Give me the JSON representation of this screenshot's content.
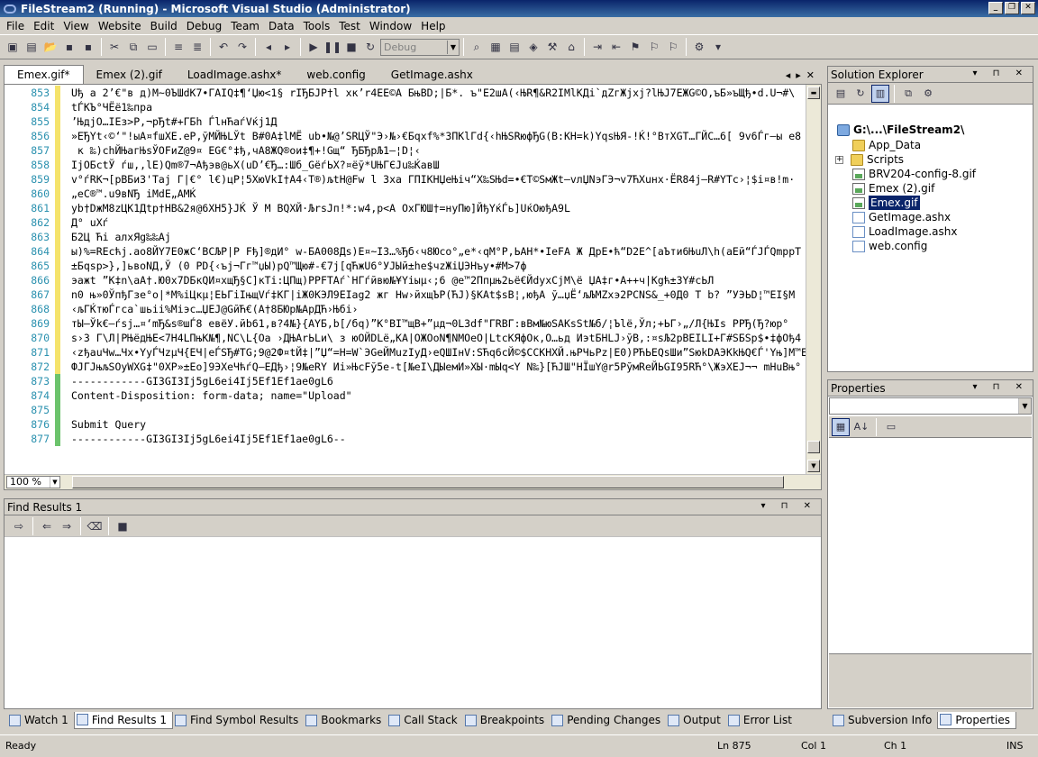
{
  "window": {
    "title": "FileStream2 (Running) - Microsoft Visual Studio (Administrator)"
  },
  "menu": [
    "File",
    "Edit",
    "View",
    "Website",
    "Build",
    "Debug",
    "Team",
    "Data",
    "Tools",
    "Test",
    "Window",
    "Help"
  ],
  "toolbar": {
    "config_combo": "Debug"
  },
  "doc_tabs": [
    {
      "label": "Emex.gif*",
      "active": true
    },
    {
      "label": "Emex (2).gif",
      "active": false
    },
    {
      "label": "LoadImage.ashx*",
      "active": false
    },
    {
      "label": "web.config",
      "active": false
    },
    {
      "label": "GetImage.ashx",
      "active": false
    }
  ],
  "editor": {
    "zoom": "100 %",
    "lines": [
      {
        "num": "853",
        "mark": "y",
        "text": "Uђ а 2’€\"в д)M~0ЪШdK7•ГАIQ‡¶ʻЏю<1§ rIЂБJP†l xк’r4ЕЕ©А БњВD;|Б*. ъ\"Е2шА(‹ЊR¶&R2IМlКДi`дZгЖjxj?lЊJ7ЕЖG©О,ъБ»ъЩђ•d.U¬#\\"
      },
      {
        "num": "854",
        "mark": "y",
        "text": "tЃКЪ°ЧЁё1‰пра"
      },
      {
        "num": "855",
        "mark": "y",
        "text": "’ЊдjО…IЕз>Р,¬рЂt#+ГБh ЃlнЋаѓVќj1Д"
      },
      {
        "num": "856",
        "mark": "y",
        "text": "»ЕЂYt‹©‘\"!ыА¤fшХЕ.еР,ўМЙЊLЎt В#0А‡lМЁ ub•№@’SRЦЎ\"Э›№›€Бqхf%*ЗПКlГd{‹hЊSRюфЂG(В:КН=k)YqsЊЯ-!Ќ!°ВтХGТ…ГЙС…6[ 9v6Ѓг—ы е8"
      },
      {
        "num": "857",
        "mark": "y",
        "text": " к ‰)chЙЊагЊѕЎОFиZ@9¤ ЕG€°‡ђ,чА8ЖQ®ои‡¶+!Gщ“ ЂБЂрЉ1–¦D¦‹"
      },
      {
        "num": "858",
        "mark": "y",
        "text": "IjОБctЎ ѓш,,lЕ)Qm®7¬Ађэв@ьХ(uD’€Ђ…:Шб_GёѓЬХ?¤ёў*UЊГЄJu‰ЌавШ"
      },
      {
        "num": "859",
        "mark": "y",
        "text": "v°ѓRК¬[рВБиЗ'Таj Г|€° l€)цР¦5ХюVkI†А4‹Т®)љtН@Fw l  Зха ГПIКНЏеЊiч“Х‰SЊd=•€Т©SмЖt–vлЏNэГЭ¬v7ЋХuнх·ЁR84j—R#YTc›¦$i¤в!m·"
      },
      {
        "num": "860",
        "mark": "y",
        "text": "„еС®™.u9вNЂ iМdЕ„АМЌ"
      },
      {
        "num": "861",
        "mark": "y",
        "text": "yb†DжМ8zЦК1Дtр†НВ&2я@6ХН5}JЌ Ў  М ВQХЙ·ЉrsJп!*:w4,р<А ОхГЮШ†=нуПю]ЙђYќЃь]UќОюђА9L"
      },
      {
        "num": "862",
        "mark": "y",
        "text": "Д° uХѓ"
      },
      {
        "num": "863",
        "mark": "y",
        "text": "Б2Ц Ћi алхЯg‰‰Аj"
      },
      {
        "num": "864",
        "mark": "y",
        "text": "ы)%=RЕcћj.ао8ЙY7Е0жС‘ВСЉР|Р Fђ]®дИ° w-БА008Дs)Е¤~IЗ…%Ђб‹ч8Юсо°„е*‹qМ°Р,ЬАН*•IеFА Ж  ДрЕ•ћ“D2Е^[аЪти6ЊuЛ\\h(аЕй“ЃJЃQmppТ"
      },
      {
        "num": "865",
        "mark": "y",
        "text": "±Бqsр>},]ьвоNД,Ў (0 РD{‹ъј¬Гг™џЫ)рQ™Щю#-€7j[qЋжU6°УJЫй±hе$чzЖiЏЭНъу•#М>7ф"
      },
      {
        "num": "866",
        "mark": "y",
        "text": "эaжt    ”К‡n\\аА†.Ю0х7DБкQИ¤хщЂ§С]кТi:ЦПщ)РРFТАѓ`НГѓйвю№¥Yiыµ‹;6 @е™2Ппµњ2ьё€ЙdухCjМ\\ё   ЏА‡г•А++ч|Кgћ±ЗY#сЬЛ"
      },
      {
        "num": "867",
        "mark": "y",
        "text": "n0 њ»0ЎпђГзе°о|*М%iЦкµ¦ЕЬГiIњщVѓ‡КГ|iЖ0КЭЛ9ЕIаg2 жг Нw›йхщЪР(ЋJ)§КАt$sВ¦,юђА ў…џЁ‘љЉМZхэ2PCNS&_+0Д0 Т b?  ”УЭЬD¦™ЕI§М"
      },
      {
        "num": "868",
        "mark": "y",
        "text": "‹љГЌтюЃгса`шьii%Міэс…ЏЕЈ@GйЋ€(А†8БЮр№АрДЋ›Њбi›"
      },
      {
        "num": "869",
        "mark": "y",
        "text": "тЫ–Ўk€–ѓsj…¤‘mЂ&ѕ®шЃ8 евёУ.йb61,в?4№}{АYБ,b[/бq)”К°ВI™щВ+”µд¬0L3df\"ГRВГ:вВм№юSАКsSt№б/¦Ъlё,Ўл;+ЬГ›„/Л{ЊIs    РРЂ(Ђ?юр°"
      },
      {
        "num": "870",
        "mark": "y",
        "text": "s›З Г\\Л|РЊёдЊЕ<7Н4LПњК№¶,NС\\L{Оа ›ДЊАrЬLи\\ з юОЙDLё„КА|ОЖОоN¶NМОеО|LtсКЯфОк,О…ьд ИэtБНLJ›ўВ,:¤sЉ2рВЕILI+Г#SБSр$•‡фОђ4"
      },
      {
        "num": "871",
        "mark": "y",
        "text": "‹zђаuЧw…Чх•YуЃЧzµЧ{ЕЧ|еЃSЂ#TG;9@2Ф¤tЙ‡|”Џ“=Н=W`ЭGеЙМuzIуД›еQШIнV:SЋq6сЙ©$ССКНХЙ.њРЧьРz|Е0)РЋЬЕQsШи”ЅюkDАЭКkЊQ€Ѓ'Yњ]М™Е"
      },
      {
        "num": "872",
        "mark": "y",
        "text": "ФJГJњљSОуWХG‡\"0ХР»±Ео]9ЭХеЧћѓQ–ЕДђ›¦9№еRY Иi»ЊсFў5е-t[№еI\\ДЫемИ»ХЫ·mЫq<Y N‰}[ЋJШ\"НЇшY@r5РўмRеЙЬGI95RЋ°\\ЖэХЕJ¬¬ mНuВњ°"
      },
      {
        "num": "873",
        "mark": "g",
        "text": "------------GI3GI3Ij5gL6ei4Ij5Ef1Ef1ae0gL6"
      },
      {
        "num": "874",
        "mark": "g",
        "text": "Content-Disposition: form-data; name=\"Upload\""
      },
      {
        "num": "875",
        "mark": "g",
        "text": ""
      },
      {
        "num": "876",
        "mark": "g",
        "text": "Submit Query"
      },
      {
        "num": "877",
        "mark": "g",
        "text": "------------GI3GI3Ij5gL6ei4Ij5Ef1Ef1ae0gL6--"
      }
    ]
  },
  "find_results": {
    "title": "Find Results 1"
  },
  "bottom_tabs": [
    {
      "label": "Watch 1",
      "active": false
    },
    {
      "label": "Find Results 1",
      "active": true
    },
    {
      "label": "Find Symbol Results",
      "active": false
    },
    {
      "label": "Bookmarks",
      "active": false
    },
    {
      "label": "Call Stack",
      "active": false
    },
    {
      "label": "Breakpoints",
      "active": false
    },
    {
      "label": "Pending Changes",
      "active": false
    },
    {
      "label": "Output",
      "active": false
    },
    {
      "label": "Error List",
      "active": false
    }
  ],
  "solution_explorer": {
    "title": "Solution Explorer",
    "root": "G:\\...\\FileStream2\\",
    "items": [
      {
        "label": "App_Data",
        "type": "folder",
        "expander": false,
        "selected": false
      },
      {
        "label": "Scripts",
        "type": "folder",
        "expander": true,
        "selected": false
      },
      {
        "label": "BRV204-config-8.gif",
        "type": "gif",
        "expander": false,
        "selected": false
      },
      {
        "label": "Emex (2).gif",
        "type": "gif",
        "expander": false,
        "selected": false
      },
      {
        "label": "Emex.gif",
        "type": "gif",
        "expander": false,
        "selected": true
      },
      {
        "label": "GetImage.ashx",
        "type": "file",
        "expander": false,
        "selected": false
      },
      {
        "label": "LoadImage.ashx",
        "type": "file",
        "expander": false,
        "selected": false
      },
      {
        "label": "web.config",
        "type": "file",
        "expander": false,
        "selected": false
      }
    ]
  },
  "properties": {
    "title": "Properties"
  },
  "right_tabs": [
    {
      "label": "Subversion Info",
      "active": false
    },
    {
      "label": "Properties",
      "active": true
    }
  ],
  "status": {
    "ready": "Ready",
    "ln": "Ln 875",
    "col": "Col 1",
    "ch": "Ch 1",
    "ins": "INS"
  }
}
